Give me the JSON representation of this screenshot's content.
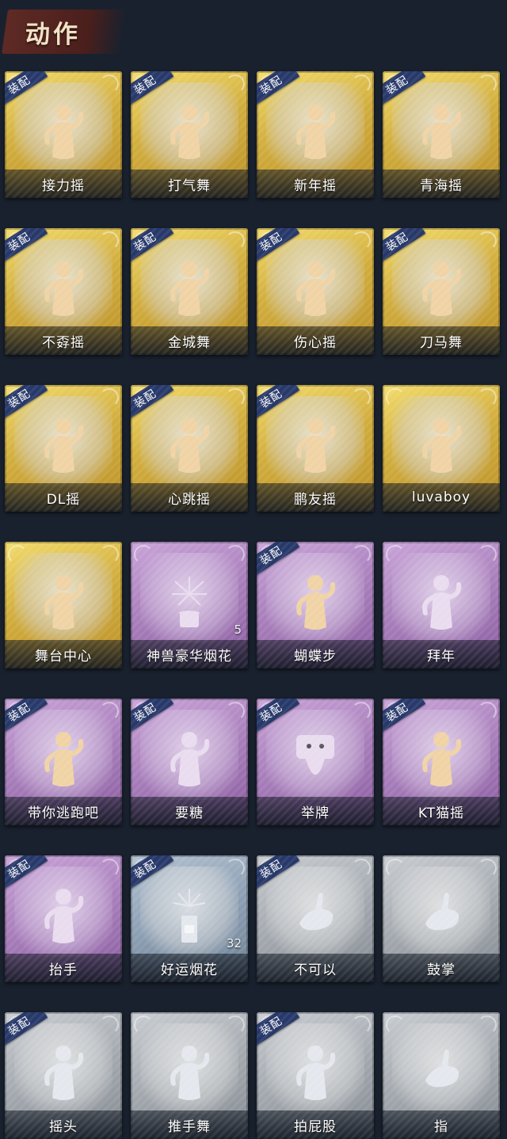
{
  "header": {
    "title": "动作"
  },
  "equip_label": "装配",
  "colors": {
    "background": "#19212e",
    "gold": "#d1ad3c",
    "purple": "#a67cb9",
    "blue": "#8a9db1",
    "gray": "#a2a8ae",
    "equip_badge": "#27386a"
  },
  "items": [
    {
      "label": "接力摇",
      "rarity": "gold",
      "equipped": true,
      "icon": "dance-pose-icon",
      "count": ""
    },
    {
      "label": "打气舞",
      "rarity": "gold",
      "equipped": true,
      "icon": "dance-pose-icon",
      "count": ""
    },
    {
      "label": "新年摇",
      "rarity": "gold",
      "equipped": true,
      "icon": "dance-pose-icon",
      "count": ""
    },
    {
      "label": "青海摇",
      "rarity": "gold",
      "equipped": true,
      "icon": "dance-pose-icon",
      "count": ""
    },
    {
      "label": "不孬摇",
      "rarity": "gold",
      "equipped": true,
      "icon": "dance-pose-icon",
      "count": ""
    },
    {
      "label": "金城舞",
      "rarity": "gold",
      "equipped": true,
      "icon": "dance-pose-icon",
      "count": ""
    },
    {
      "label": "伤心摇",
      "rarity": "gold",
      "equipped": true,
      "icon": "heart-hands-pose-icon",
      "count": ""
    },
    {
      "label": "刀马舞",
      "rarity": "gold",
      "equipped": true,
      "icon": "dance-pose-icon",
      "count": ""
    },
    {
      "label": "DL摇",
      "rarity": "gold",
      "equipped": true,
      "icon": "dance-pose-icon",
      "count": ""
    },
    {
      "label": "心跳摇",
      "rarity": "gold",
      "equipped": true,
      "icon": "dance-pose-icon",
      "count": ""
    },
    {
      "label": "鹏友摇",
      "rarity": "gold",
      "equipped": true,
      "icon": "dance-pose-icon",
      "count": ""
    },
    {
      "label": "luvaboy",
      "rarity": "gold",
      "equipped": false,
      "icon": "dance-pose-icon",
      "count": ""
    },
    {
      "label": "舞台中心",
      "rarity": "gold",
      "equipped": false,
      "icon": "dance-pose-icon",
      "count": ""
    },
    {
      "label": "神兽豪华烟花",
      "rarity": "purple",
      "equipped": false,
      "icon": "firework-icon",
      "count": "5"
    },
    {
      "label": "蝴蝶步",
      "rarity": "purple",
      "equipped": true,
      "icon": "dance-pose-icon",
      "count": ""
    },
    {
      "label": "拜年",
      "rarity": "purple",
      "equipped": false,
      "icon": "greeting-pose-icon",
      "count": ""
    },
    {
      "label": "带你逃跑吧",
      "rarity": "purple",
      "equipped": true,
      "icon": "dance-pose-icon",
      "count": ""
    },
    {
      "label": "要糖",
      "rarity": "purple",
      "equipped": true,
      "icon": "reach-pose-icon",
      "count": ""
    },
    {
      "label": "举牌",
      "rarity": "purple",
      "equipped": true,
      "icon": "sign-pose-icon",
      "count": ""
    },
    {
      "label": "KT猫摇",
      "rarity": "purple",
      "equipped": true,
      "icon": "dance-pose-icon",
      "count": ""
    },
    {
      "label": "抬手",
      "rarity": "purple",
      "equipped": true,
      "icon": "raise-hand-pose-icon",
      "count": ""
    },
    {
      "label": "好运烟花",
      "rarity": "blue",
      "equipped": true,
      "icon": "firecracker-icon",
      "count": "32"
    },
    {
      "label": "不可以",
      "rarity": "gray",
      "equipped": true,
      "icon": "finger-wag-icon",
      "count": ""
    },
    {
      "label": "鼓掌",
      "rarity": "gray",
      "equipped": false,
      "icon": "clap-icon",
      "count": ""
    },
    {
      "label": "摇头",
      "rarity": "gray",
      "equipped": true,
      "icon": "shake-head-pose-icon",
      "count": ""
    },
    {
      "label": "推手舞",
      "rarity": "gray",
      "equipped": false,
      "icon": "push-hands-pose-icon",
      "count": ""
    },
    {
      "label": "拍屁股",
      "rarity": "gray",
      "equipped": true,
      "icon": "pat-pose-icon",
      "count": ""
    },
    {
      "label": "指",
      "rarity": "gray",
      "equipped": false,
      "icon": "point-hand-icon",
      "count": ""
    }
  ]
}
